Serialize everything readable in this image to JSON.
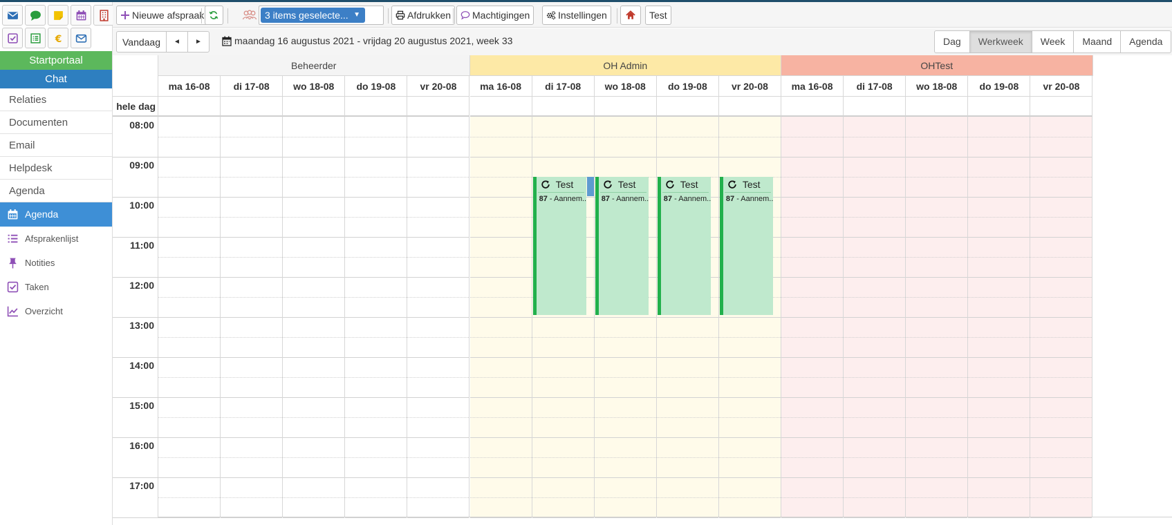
{
  "sidebar": {
    "icons": [
      {
        "name": "mail-icon",
        "color": "#2e6fb5"
      },
      {
        "name": "chat-icon",
        "color": "#2a9d3e"
      },
      {
        "name": "sticky-note-icon",
        "color": "#f2c200"
      },
      {
        "name": "calendar-icon",
        "color": "#8e4fb6"
      },
      {
        "name": "building-icon",
        "color": "#c0392b"
      },
      {
        "name": "checkbox-icon",
        "color": "#8e4fb6"
      },
      {
        "name": "list-icon",
        "color": "#2a9d3e"
      },
      {
        "name": "euro-icon",
        "color": "#e6a800"
      },
      {
        "name": "envelope-icon",
        "color": "#2e6fb5"
      }
    ],
    "startportaal": "Startportaal",
    "chat": "Chat",
    "links": [
      "Relaties",
      "Documenten",
      "Email",
      "Helpdesk",
      "Agenda"
    ],
    "sub_items": [
      {
        "label": "Agenda",
        "icon": "calendar-icon",
        "active": true
      },
      {
        "label": "Afsprakenlijst",
        "icon": "list-icon",
        "active": false
      },
      {
        "label": "Notities",
        "icon": "pin-icon",
        "active": false
      },
      {
        "label": "Taken",
        "icon": "checkbox-icon",
        "active": false
      },
      {
        "label": "Overzicht",
        "icon": "chart-icon",
        "active": false
      }
    ]
  },
  "toolbar": {
    "new_label": "Nieuwe afspraak",
    "select_label": "3 items geselecte...",
    "print_label": "Afdrukken",
    "permissions_label": "Machtigingen",
    "settings_label": "Instellingen",
    "test_label": "Test"
  },
  "nav": {
    "today_label": "Vandaag",
    "prev_label": "◄",
    "next_label": "►",
    "date_range": "maandag 16 augustus 2021 - vrijdag 20 augustus 2021, week 33",
    "views": [
      "Dag",
      "Werkweek",
      "Week",
      "Maand",
      "Agenda"
    ],
    "active_view": "Werkweek"
  },
  "calendar": {
    "allday_label": "hele dag",
    "days": [
      "ma 16-08",
      "di 17-08",
      "wo 18-08",
      "do 19-08",
      "vr 20-08"
    ],
    "resources": [
      {
        "name": "Beheerder",
        "header_color": "#f4f4f4",
        "body_color": "#ffffff"
      },
      {
        "name": "OH Admin",
        "header_color": "#fde9a6",
        "body_color": "#fffbea"
      },
      {
        "name": "OHTest",
        "header_color": "#f7b3a2",
        "body_color": "#fdeeee"
      }
    ],
    "hours": [
      "08:00",
      "09:00",
      "10:00",
      "11:00",
      "12:00",
      "13:00",
      "14:00",
      "15:00",
      "16:00",
      "17:00"
    ],
    "events": [
      {
        "resource": 1,
        "day": 1,
        "start": 9.5,
        "end": 12.95,
        "title": "Test",
        "desc_num": "87",
        "desc_text": " - Aannem...",
        "color": "#bfe9cd",
        "bar_color": "#22b04c"
      },
      {
        "resource": 1,
        "day": 2,
        "start": 9.5,
        "end": 12.95,
        "title": "Test",
        "desc_num": "87",
        "desc_text": " - Aannem...",
        "color": "#bfe9cd",
        "bar_color": "#22b04c"
      },
      {
        "resource": 1,
        "day": 3,
        "start": 9.5,
        "end": 12.95,
        "title": "Test",
        "desc_num": "87",
        "desc_text": " - Aannem...",
        "color": "#bfe9cd",
        "bar_color": "#22b04c"
      },
      {
        "resource": 1,
        "day": 4,
        "start": 9.5,
        "end": 12.95,
        "title": "Test",
        "desc_num": "87",
        "desc_text": " - Aannem...",
        "color": "#bfe9cd",
        "bar_color": "#22b04c"
      }
    ]
  }
}
